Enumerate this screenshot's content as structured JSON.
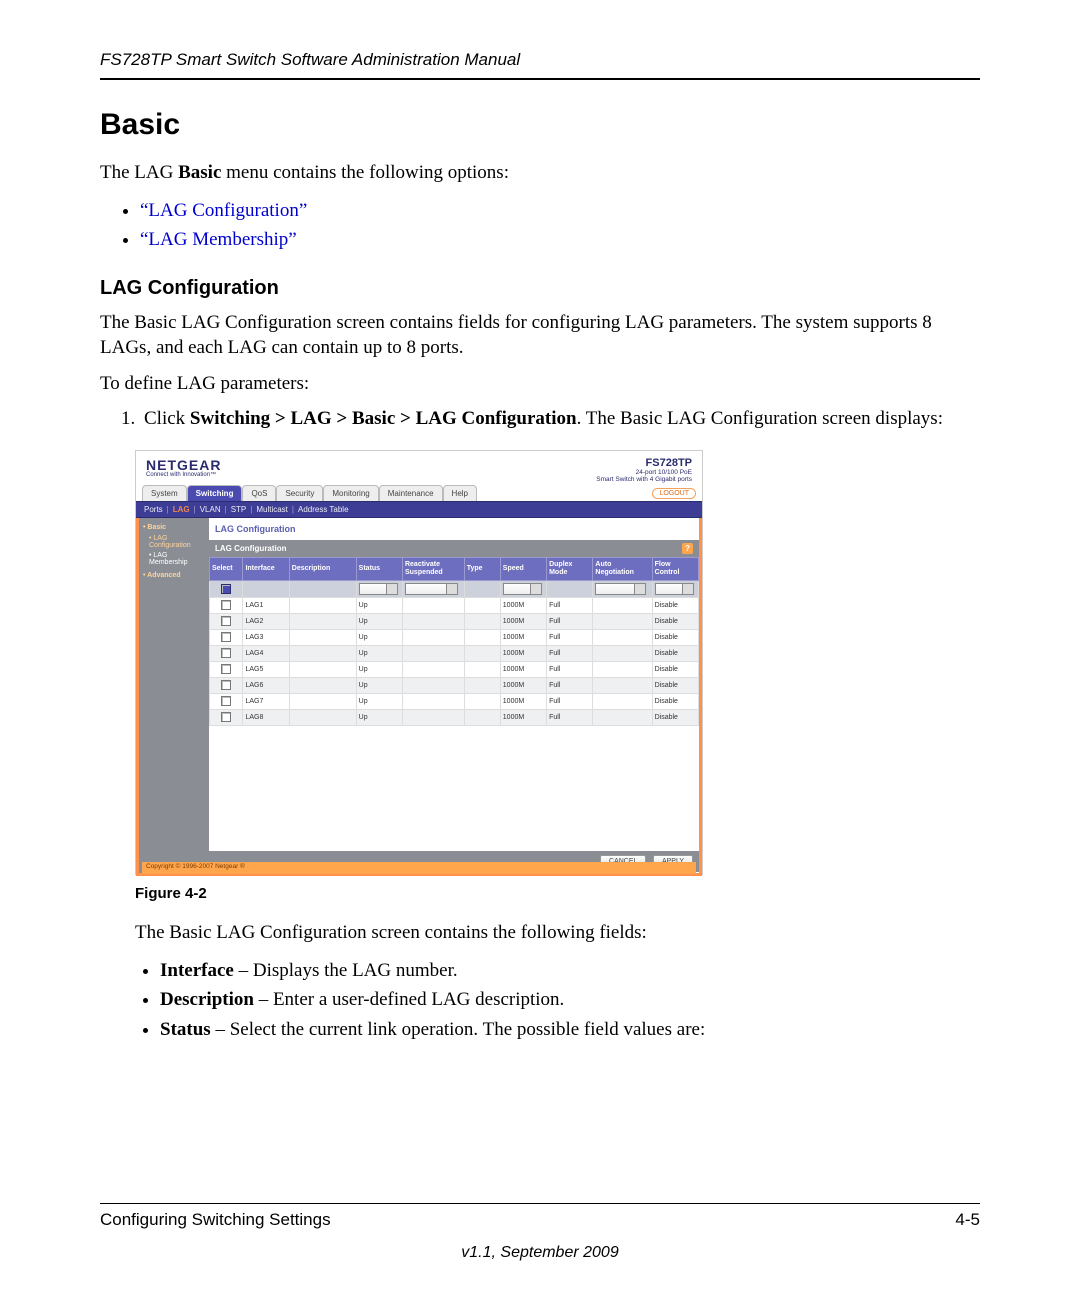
{
  "header": {
    "running_title": "FS728TP Smart Switch Software Administration Manual"
  },
  "heading": "Basic",
  "intro_prefix": "The LAG ",
  "intro_bold": "Basic",
  "intro_suffix": " menu contains the following options:",
  "links": {
    "lag_config": "“LAG Configuration”",
    "lag_membership": "“LAG Membership”"
  },
  "subheading": "LAG Configuration",
  "para1": "The Basic LAG Configuration screen contains fields for configuring LAG parameters. The system supports 8 LAGs, and each LAG can contain up to 8 ports.",
  "para2": "To define LAG parameters:",
  "step1_prefix": "Click ",
  "step1_bold": "Switching > LAG > Basic > LAG Configuration",
  "step1_suffix": ". The Basic LAG Configuration screen displays:",
  "figure_caption": "Figure 4-2",
  "after_fig": "The Basic LAG Configuration screen contains the following fields:",
  "fields": {
    "f1_b": "Interface",
    "f1_t": " – Displays the LAG number.",
    "f2_b": "Description",
    "f2_t": " – Enter a user-defined LAG description.",
    "f3_b": "Status",
    "f3_t": " – Select the current link operation. The possible field values are:"
  },
  "footer": {
    "left": "Configuring Switching Settings",
    "right": "4-5",
    "version": "v1.1, September 2009"
  },
  "shot": {
    "brand": "NETGEAR",
    "tagline": "Connect with Innovation™",
    "model": "FS728TP",
    "model_sub1": "24-port 10/100 PoE",
    "model_sub2": "Smart Switch with 4 Gigabit ports",
    "logout": "LOGOUT",
    "tabs": [
      "System",
      "Switching",
      "QoS",
      "Security",
      "Monitoring",
      "Maintenance",
      "Help"
    ],
    "active_tab_index": 1,
    "subtabs": [
      "Ports",
      "LAG",
      "VLAN",
      "STP",
      "Multicast",
      "Address Table"
    ],
    "active_subtab_index": 1,
    "side_head": "• Basic",
    "side_items": [
      "• LAG Configuration",
      "• LAG Membership"
    ],
    "side_advanced": "• Advanced",
    "title": "LAG Configuration",
    "box_title": "LAG Configuration",
    "columns": [
      "Select",
      "Interface",
      "Description",
      "Status",
      "Reactivate Suspended",
      "Type",
      "Speed",
      "Duplex Mode",
      "Auto Negotiation",
      "Flow Control"
    ],
    "rows": [
      {
        "iface": "LAG1",
        "status": "Up",
        "speed": "1000M",
        "duplex": "Full",
        "flow": "Disable",
        "alt": false
      },
      {
        "iface": "LAG2",
        "status": "Up",
        "speed": "1000M",
        "duplex": "Full",
        "flow": "Disable",
        "alt": true
      },
      {
        "iface": "LAG3",
        "status": "Up",
        "speed": "1000M",
        "duplex": "Full",
        "flow": "Disable",
        "alt": false
      },
      {
        "iface": "LAG4",
        "status": "Up",
        "speed": "1000M",
        "duplex": "Full",
        "flow": "Disable",
        "alt": true
      },
      {
        "iface": "LAG5",
        "status": "Up",
        "speed": "1000M",
        "duplex": "Full",
        "flow": "Disable",
        "alt": false
      },
      {
        "iface": "LAG6",
        "status": "Up",
        "speed": "1000M",
        "duplex": "Full",
        "flow": "Disable",
        "alt": true
      },
      {
        "iface": "LAG7",
        "status": "Up",
        "speed": "1000M",
        "duplex": "Full",
        "flow": "Disable",
        "alt": false
      },
      {
        "iface": "LAG8",
        "status": "Up",
        "speed": "1000M",
        "duplex": "Full",
        "flow": "Disable",
        "alt": true
      }
    ],
    "btn_cancel": "CANCEL",
    "btn_apply": "APPLY",
    "copyright": "Copyright © 1996-2007 Netgear ®"
  }
}
